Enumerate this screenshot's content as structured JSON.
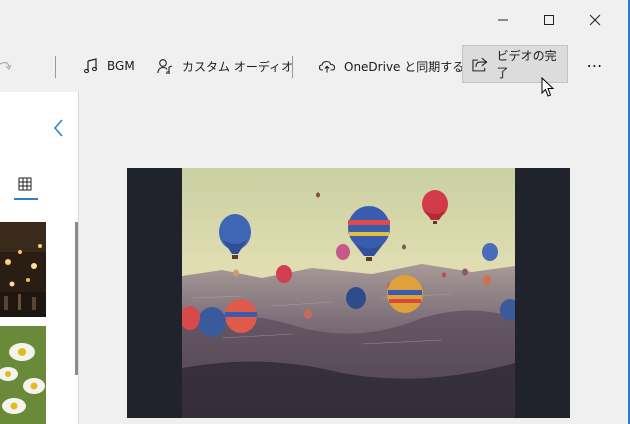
{
  "window": {
    "controls": {
      "minimize": "minimize-icon",
      "maximize": "maximize-icon",
      "close": "close-icon"
    }
  },
  "toolbar": {
    "bgm_label": "BGM",
    "custom_audio_label": "カスタム オーディオ",
    "onedrive_label": "OneDrive と同期する",
    "finish_label": "ビデオの完了",
    "more_label": "⋯"
  },
  "sidebar": {
    "collapse_icon": "chevron-left-icon",
    "grid_view_icon": "grid-icon"
  },
  "preview": {
    "image": "hot-air-balloons-photo"
  },
  "colors": {
    "accent": "#2b7fd4",
    "window_bg": "#f0f0f0",
    "preview_bg": "#20222c"
  }
}
